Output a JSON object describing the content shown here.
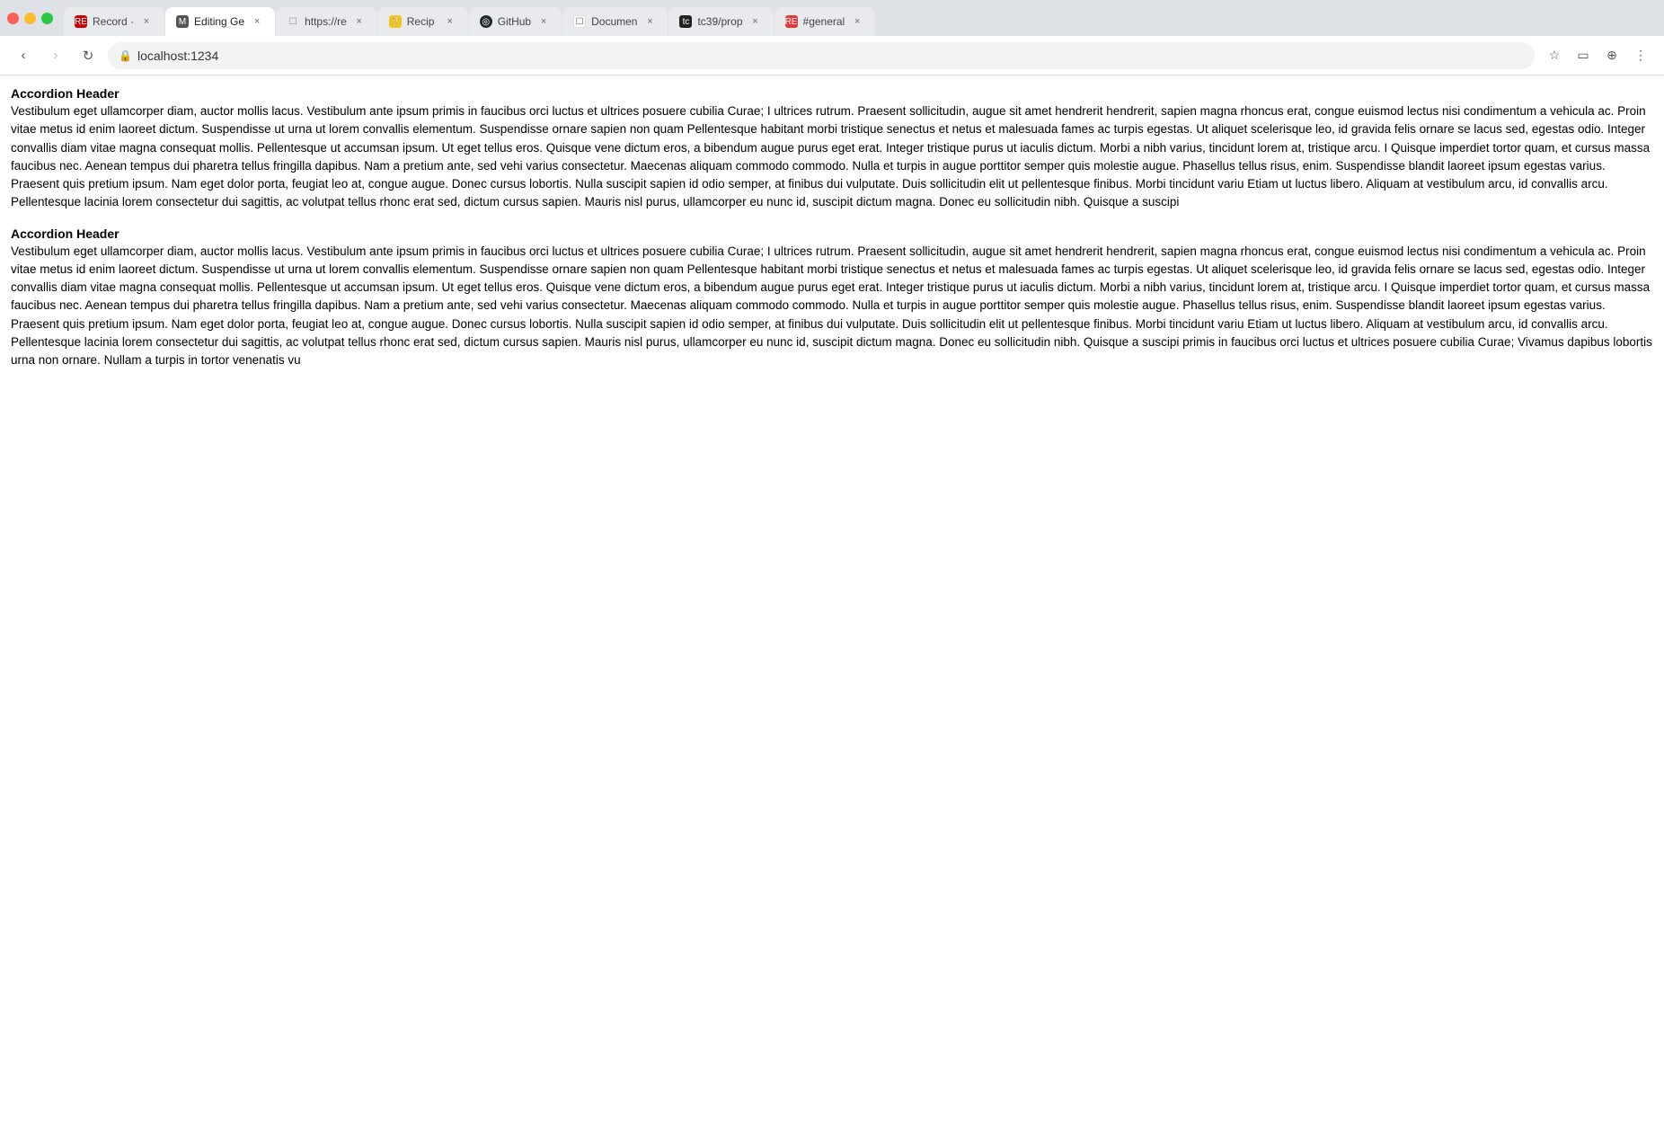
{
  "browser": {
    "tabs": [
      {
        "id": "tab-record",
        "favicon_char": "RE",
        "favicon_class": "favicon-re",
        "label": "Record ·",
        "active": false
      },
      {
        "id": "tab-editing",
        "favicon_char": "M",
        "favicon_class": "favicon-m",
        "label": "Editing Ge",
        "active": true
      },
      {
        "id": "tab-https",
        "favicon_char": "☐",
        "favicon_class": "favicon-page",
        "label": "https://re",
        "active": false
      },
      {
        "id": "tab-recipe",
        "favicon_char": "🍴",
        "favicon_class": "favicon-recipe",
        "label": "Recip",
        "active": false
      },
      {
        "id": "tab-github",
        "favicon_char": "◎",
        "favicon_class": "favicon-github",
        "label": "GitHub",
        "active": false
      },
      {
        "id": "tab-docs",
        "favicon_char": "☐",
        "favicon_class": "favicon-docs",
        "label": "Documen",
        "active": false
      },
      {
        "id": "tab-tc39",
        "favicon_char": "tc",
        "favicon_class": "favicon-tc39",
        "label": "tc39/prop",
        "active": false
      },
      {
        "id": "tab-general",
        "favicon_char": "RE",
        "favicon_class": "favicon-general",
        "label": "#general",
        "active": false
      }
    ],
    "url": "localhost:1234",
    "back_disabled": false,
    "forward_disabled": true
  },
  "page": {
    "sections": [
      {
        "header": "Accordion Header",
        "body": "Vestibulum eget ullamcorper diam, auctor mollis lacus. Vestibulum ante ipsum primis in faucibus orci luctus et ultrices posuere cubilia Curae; I ultrices rutrum. Praesent sollicitudin, augue sit amet hendrerit hendrerit, sapien magna rhoncus erat, congue euismod lectus nisi condimentum a vehicula ac. Proin vitae metus id enim laoreet dictum. Suspendisse ut urna ut lorem convallis elementum. Suspendisse ornare sapien non quam Pellentesque habitant morbi tristique senectus et netus et malesuada fames ac turpis egestas. Ut aliquet scelerisque leo, id gravida felis ornare se lacus sed, egestas odio. Integer convallis diam vitae magna consequat mollis. Pellentesque ut accumsan ipsum. Ut eget tellus eros. Quisque vene dictum eros, a bibendum augue purus eget erat. Integer tristique purus ut iaculis dictum. Morbi a nibh varius, tincidunt lorem at, tristique arcu. I Quisque imperdiet tortor quam, et cursus massa faucibus nec. Aenean tempus dui pharetra tellus fringilla dapibus. Nam a pretium ante, sed vehi varius consectetur. Maecenas aliquam commodo commodo. Nulla et turpis in augue porttitor semper quis molestie augue. Phasellus tellus risus, enim. Suspendisse blandit laoreet ipsum egestas varius. Praesent quis pretium ipsum. Nam eget dolor porta, feugiat leo at, congue augue. Donec cursus lobortis. Nulla suscipit sapien id odio semper, at finibus dui vulputate. Duis sollicitudin elit ut pellentesque finibus. Morbi tincidunt variu Etiam ut luctus libero. Aliquam at vestibulum arcu, id convallis arcu. Pellentesque lacinia lorem consectetur dui sagittis, ac volutpat tellus rhonc erat sed, dictum cursus sapien. Mauris nisl purus, ullamcorper eu nunc id, suscipit dictum magna. Donec eu sollicitudin nibh. Quisque a suscipi"
      },
      {
        "header": "Accordion Header",
        "body": "Vestibulum eget ullamcorper diam, auctor mollis lacus. Vestibulum ante ipsum primis in faucibus orci luctus et ultrices posuere cubilia Curae; I ultrices rutrum. Praesent sollicitudin, augue sit amet hendrerit hendrerit, sapien magna rhoncus erat, congue euismod lectus nisi condimentum a vehicula ac. Proin vitae metus id enim laoreet dictum. Suspendisse ut urna ut lorem convallis elementum. Suspendisse ornare sapien non quam Pellentesque habitant morbi tristique senectus et netus et malesuada fames ac turpis egestas. Ut aliquet scelerisque leo, id gravida felis ornare se lacus sed, egestas odio. Integer convallis diam vitae magna consequat mollis. Pellentesque ut accumsan ipsum. Ut eget tellus eros. Quisque vene dictum eros, a bibendum augue purus eget erat. Integer tristique purus ut iaculis dictum. Morbi a nibh varius, tincidunt lorem at, tristique arcu. I Quisque imperdiet tortor quam, et cursus massa faucibus nec. Aenean tempus dui pharetra tellus fringilla dapibus. Nam a pretium ante, sed vehi varius consectetur. Maecenas aliquam commodo commodo. Nulla et turpis in augue porttitor semper quis molestie augue. Phasellus tellus risus, enim. Suspendisse blandit laoreet ipsum egestas varius. Praesent quis pretium ipsum. Nam eget dolor porta, feugiat leo at, congue augue. Donec cursus lobortis. Nulla suscipit sapien id odio semper, at finibus dui vulputate. Duis sollicitudin elit ut pellentesque finibus. Morbi tincidunt variu Etiam ut luctus libero. Aliquam at vestibulum arcu, id convallis arcu. Pellentesque lacinia lorem consectetur dui sagittis, ac volutpat tellus rhonc erat sed, dictum cursus sapien. Mauris nisl purus, ullamcorper eu nunc id, suscipit dictum magna. Donec eu sollicitudin nibh. Quisque a suscipi primis in faucibus orci luctus et ultrices posuere cubilia Curae; Vivamus dapibus lobortis urna non ornare. Nullam a turpis in tortor venenatis vu"
      }
    ]
  },
  "icons": {
    "back": "‹",
    "forward": "›",
    "reload": "↻",
    "star": "☆",
    "cast": "▭",
    "lens": "⊕",
    "menu": "⋮"
  }
}
